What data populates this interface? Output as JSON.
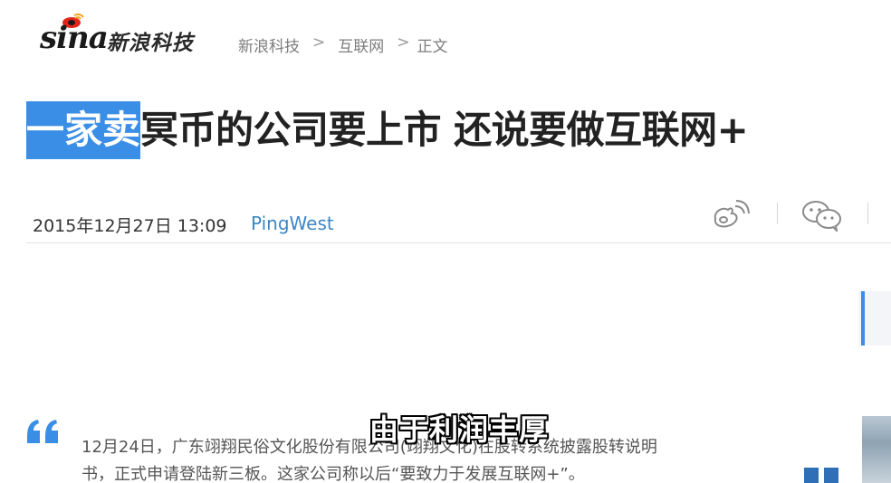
{
  "header": {
    "logo_text": "sina",
    "logo_subtitle": "新浪科技",
    "breadcrumb": [
      "新浪科技",
      "互联网",
      "正文"
    ],
    "breadcrumb_sep": ">"
  },
  "article": {
    "title_highlighted": "一家卖",
    "title_rest": "冥币的公司要上市 还说要做互联网+",
    "date": "2015年12月27日 13:09",
    "source": "PingWest"
  },
  "share": {
    "icons": [
      "weibo-icon",
      "wechat-icon"
    ]
  },
  "quote": {
    "line1": "12月24日，广东翊翔民俗文化股份有限公司(翊翔文化)在股转系统披露股转说明",
    "line2": "书，正式申请登陆新三板。这家公司称以后“要致力于发展互联网+”。"
  },
  "caption": "由于利润丰厚",
  "colors": {
    "accent": "#3a8ee6",
    "source_link": "#3d86c6",
    "highlight_text": "#ffffff"
  }
}
